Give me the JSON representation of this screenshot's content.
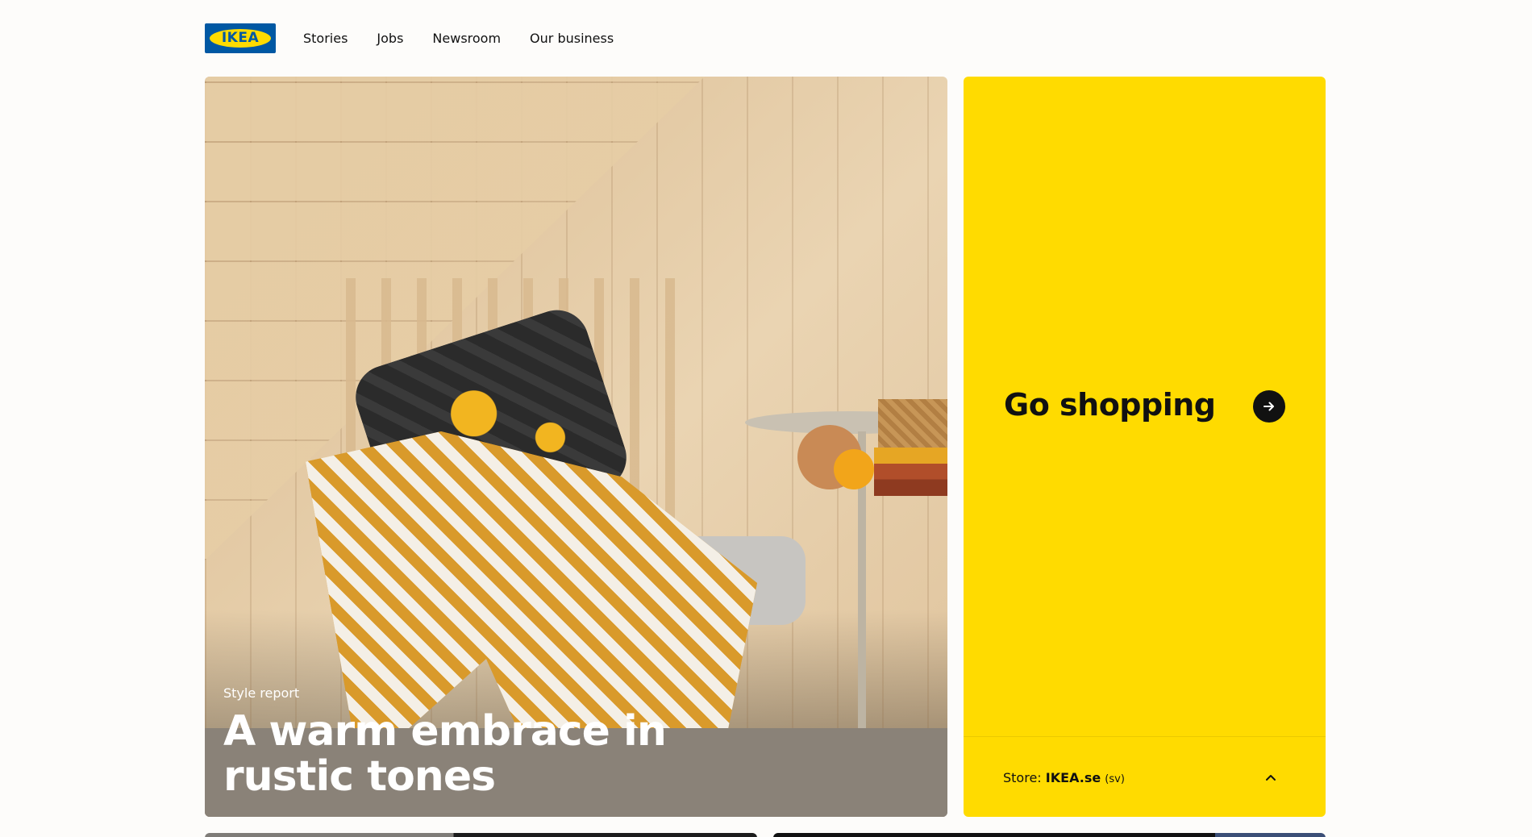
{
  "brand": {
    "logo_text": "IKEA",
    "colors": {
      "yellow": "#ffdb00",
      "blue": "#0058a3"
    }
  },
  "nav": {
    "items": [
      "Stories",
      "Jobs",
      "Newsroom",
      "Our business"
    ]
  },
  "hero": {
    "kicker": "Style report",
    "title": "A warm embrace in rustic tones"
  },
  "shop": {
    "title": "Go shopping",
    "arrow_icon": "arrow-right-icon"
  },
  "store": {
    "label": "Store:",
    "name": "IKEA.se",
    "lang": "(sv)",
    "chevron_icon": "chevron-up-icon"
  }
}
